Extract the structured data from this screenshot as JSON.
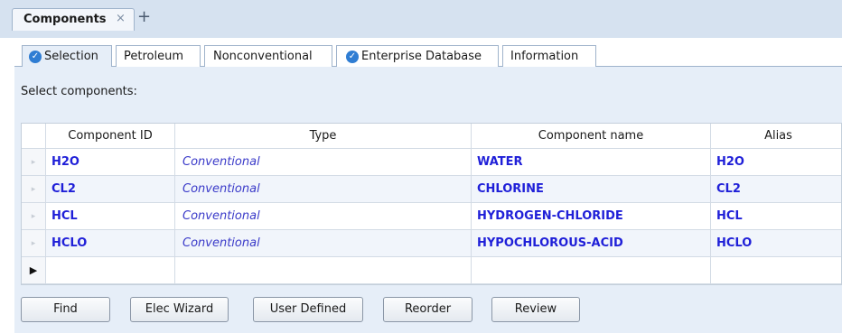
{
  "document_tab": {
    "label": "Components",
    "close_glyph": "×",
    "add_glyph": "+"
  },
  "tabs": [
    {
      "label": "Selection",
      "checked": true,
      "active": true
    },
    {
      "label": "Petroleum",
      "checked": false,
      "active": false
    },
    {
      "label": "Nonconventional",
      "checked": false,
      "active": false
    },
    {
      "label": "Enterprise Database",
      "checked": true,
      "active": false
    },
    {
      "label": "Information",
      "checked": false,
      "active": false
    }
  ],
  "prompt": "Select components:",
  "table": {
    "columns": [
      "Component ID",
      "Type",
      "Component name",
      "Alias"
    ],
    "rows": [
      {
        "id": "H2O",
        "type": "Conventional",
        "name": "WATER",
        "alias": "H2O"
      },
      {
        "id": "CL2",
        "type": "Conventional",
        "name": "CHLORINE",
        "alias": "CL2"
      },
      {
        "id": "HCL",
        "type": "Conventional",
        "name": "HYDROGEN-CHLORIDE",
        "alias": "HCL"
      },
      {
        "id": "HCLO",
        "type": "Conventional",
        "name": "HYPOCHLOROUS-ACID",
        "alias": "HCLO"
      }
    ],
    "row_marker": "▸",
    "new_row_marker": "▶"
  },
  "buttons": {
    "find": "Find",
    "elec_wizard": "Elec Wizard",
    "user_defined": "User Defined",
    "reorder": "Reorder",
    "review": "Review"
  },
  "colors": {
    "accent_blue": "#1f1fd8",
    "check_blue": "#2f7dd3",
    "panel_bg": "#e6eef8"
  }
}
